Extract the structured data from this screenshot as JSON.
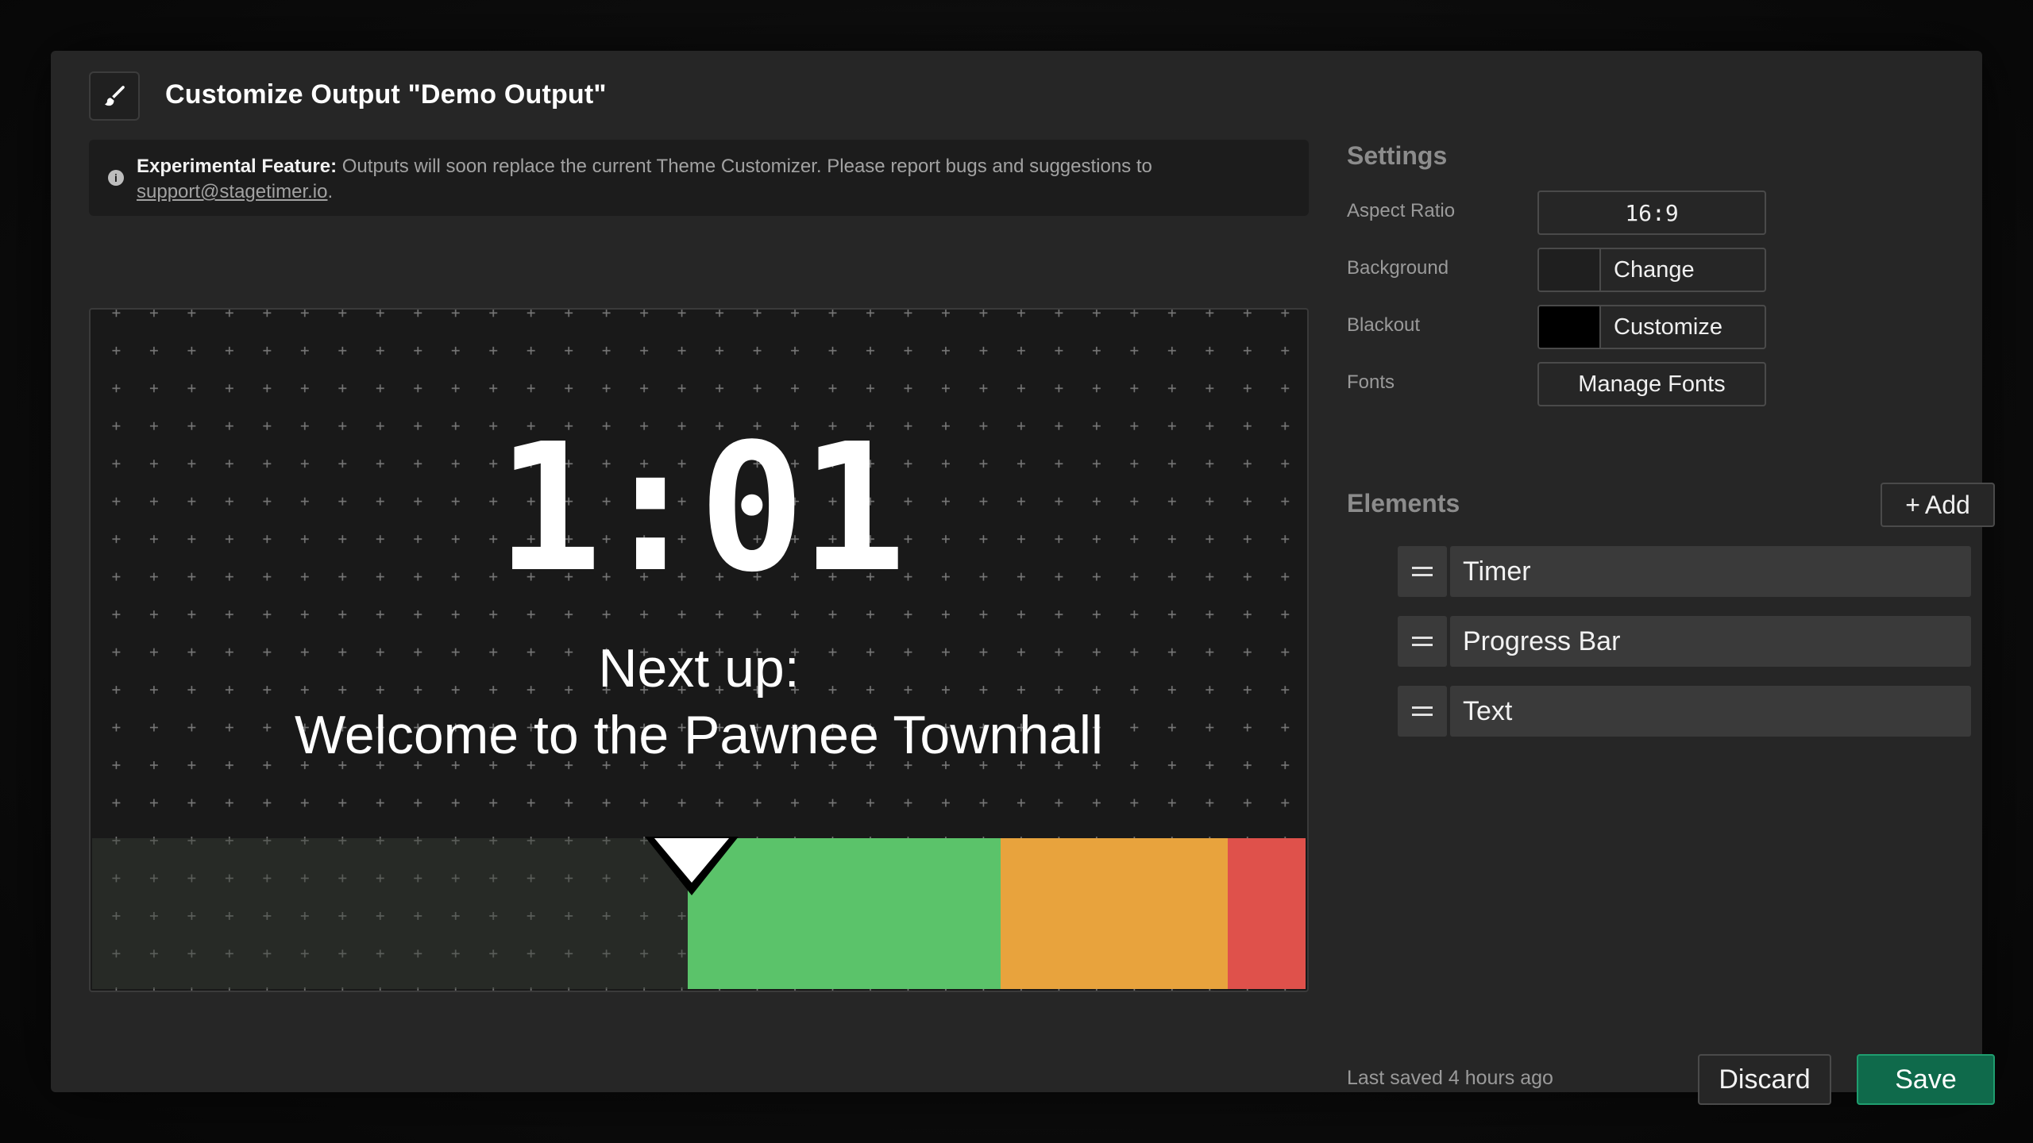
{
  "header": {
    "title": "Customize Output \"Demo Output\"",
    "icon": "paintbrush-icon"
  },
  "notice": {
    "label": "Experimental Feature:",
    "text": " Outputs will soon replace the current Theme Customizer. Please report bugs and suggestions to ",
    "email": "support@stagetimer.io",
    "suffix": "."
  },
  "preview": {
    "timer": "1:01",
    "next_label": "Next up:",
    "next_title": "Welcome to the Pawnee Townhall",
    "progress": {
      "elapsed_fraction": 0.49,
      "colors": {
        "elapsed": "#2e322c",
        "green": "#5bc36a",
        "yellow": "#e8a33d",
        "red": "#df514b"
      }
    }
  },
  "settings": {
    "title": "Settings",
    "aspect_ratio_label": "Aspect Ratio",
    "aspect_ratio_value": "16:9",
    "background_label": "Background",
    "background_button": "Change",
    "background_color": "#1f1f1f",
    "blackout_label": "Blackout",
    "blackout_button": "Customize",
    "blackout_color": "#000000",
    "fonts_label": "Fonts",
    "fonts_button": "Manage Fonts"
  },
  "elements": {
    "title": "Elements",
    "add_button": "Add",
    "items": [
      {
        "label": "Timer"
      },
      {
        "label": "Progress Bar"
      },
      {
        "label": "Text"
      }
    ]
  },
  "footer": {
    "last_saved": "Last saved 4 hours ago",
    "discard": "Discard",
    "save": "Save"
  },
  "colors": {
    "accent": "#0f6a4b",
    "panel": "#262626"
  }
}
